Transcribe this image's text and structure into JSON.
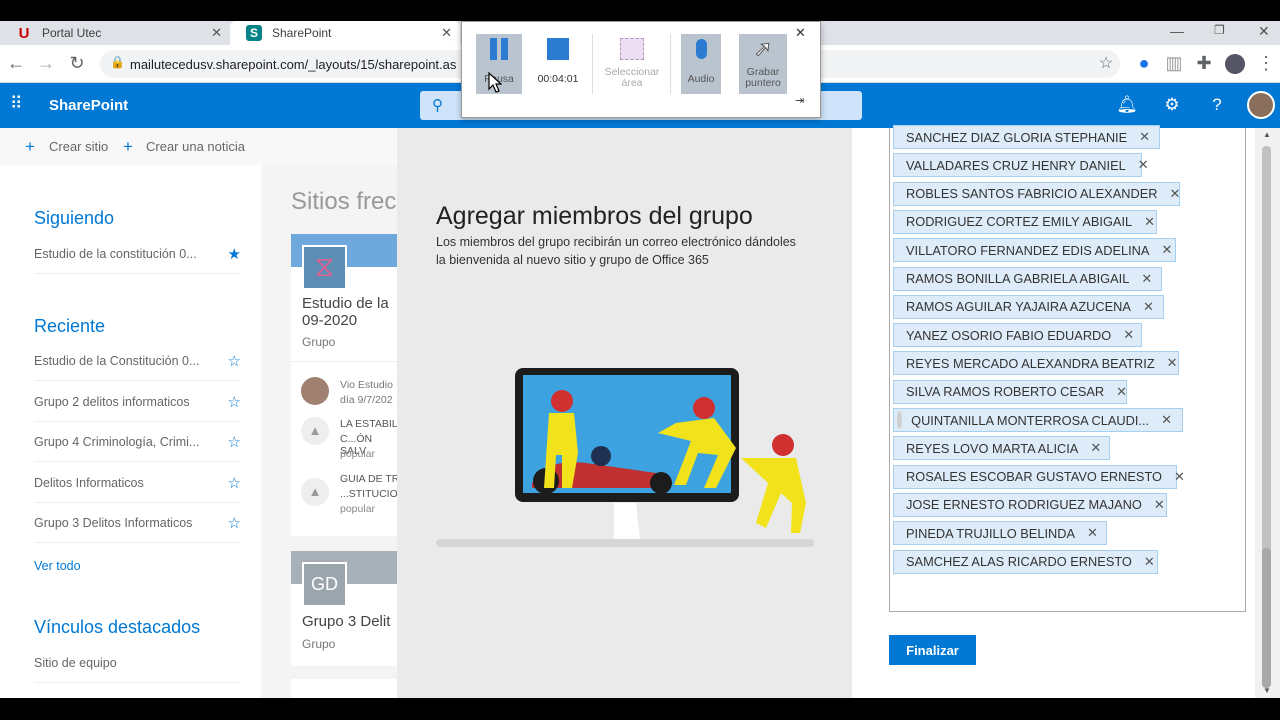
{
  "browser": {
    "tabs": [
      {
        "label": "Portal Utec",
        "favicon": "U"
      },
      {
        "label": "SharePoint",
        "favicon": "S"
      }
    ],
    "url": "mailutecedusv.sharepoint.com/_layouts/15/sharepoint.as"
  },
  "recorder": {
    "pause_label": "Pausa",
    "time": "00:04:01",
    "select_area_label": "Seleccionar\nárea",
    "audio_label": "Audio",
    "record_pointer_label": "Grabar\npuntero"
  },
  "suite": {
    "app_name": "SharePoint"
  },
  "commands": {
    "create_site": "Crear sitio",
    "create_news": "Crear una noticia"
  },
  "leftnav": {
    "following_title": "Siguiendo",
    "following_items": [
      "Estudio de la constitución 0..."
    ],
    "recent_title": "Reciente",
    "recent_items": [
      "Estudio de la Constitución 0...",
      "Grupo 2 delitos informaticos",
      "Grupo 4 Criminología, Crimi...",
      "Delitos Informaticos",
      "Grupo 3 Delitos Informaticos"
    ],
    "see_all": "Ver todo",
    "featured_title": "Vínculos destacados",
    "featured_items": [
      "Sitio de equipo"
    ]
  },
  "frequent": {
    "title": "Sitios frecu",
    "card1": {
      "name": "Estudio de la",
      "name2": "09-2020",
      "type": "Grupo",
      "activity": [
        {
          "l1": "Vio Estudio",
          "l2": "día 9/7/202"
        },
        {
          "l1": "LA ESTABIL",
          "l2": "C...ÓN SALV",
          "l3": "popular"
        },
        {
          "l1": "GUIA DE TR",
          "l2": "...STITUCIO",
          "l3": "popular"
        }
      ]
    },
    "card2": {
      "initials": "GD",
      "name": "Grupo 3 Delit",
      "type": "Grupo"
    }
  },
  "modal": {
    "title": "Agregar miembros del grupo",
    "description": "Los miembros del grupo recibirán un correo electrónico dándoles la bienvenida al nuevo sitio y grupo de Office 365",
    "members": [
      {
        "name": "SANCHEZ DIAZ GLORIA STEPHANIE",
        "photo": true
      },
      {
        "name": "VALLADARES CRUZ HENRY DANIEL",
        "photo": false
      },
      {
        "name": "ROBLES SANTOS FABRICIO ALEXANDER",
        "photo": false
      },
      {
        "name": "RODRIGUEZ CORTEZ EMILY ABIGAIL",
        "photo": false
      },
      {
        "name": "VILLATORO FERNANDEZ EDIS ADELINA",
        "photo": false
      },
      {
        "name": "RAMOS BONILLA GABRIELA ABIGAIL",
        "photo": false
      },
      {
        "name": "RAMOS AGUILAR YAJAIRA AZUCENA",
        "photo": false
      },
      {
        "name": "YANEZ OSORIO FABIO EDUARDO",
        "photo": false
      },
      {
        "name": "REYES MERCADO ALEXANDRA BEATRIZ",
        "photo": true
      },
      {
        "name": "SILVA RAMOS ROBERTO CESAR",
        "photo": false
      },
      {
        "name": "QUINTANILLA MONTERROSA CLAUDI...",
        "photo": false
      },
      {
        "name": "REYES LOVO MARTA ALICIA",
        "photo": false
      },
      {
        "name": "ROSALES ESCOBAR GUSTAVO ERNESTO",
        "photo": true
      },
      {
        "name": "JOSE ERNESTO RODRIGUEZ MAJANO",
        "photo": true
      },
      {
        "name": "PINEDA TRUJILLO BELINDA",
        "photo": false
      },
      {
        "name": "SAMCHEZ ALAS RICARDO ERNESTO",
        "photo": true
      }
    ],
    "finish_label": "Finalizar"
  },
  "colors": {
    "accent": "#0078d4",
    "pill_bg": "#deecf9"
  }
}
